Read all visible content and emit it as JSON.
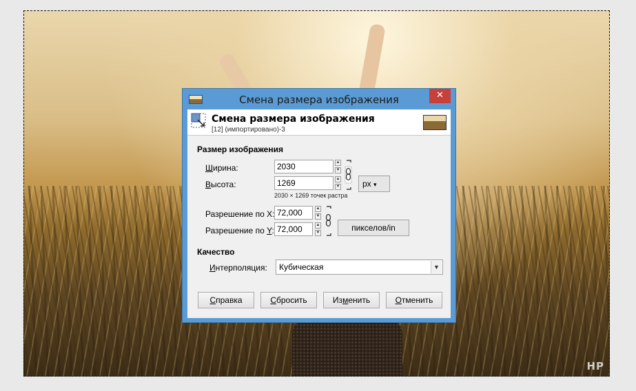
{
  "dialog": {
    "window_title": "Смена размера изображения",
    "header_title": "Смена размера изображения",
    "header_subtitle": "[12] (импортировано)-3",
    "close_glyph": "✕"
  },
  "image_size": {
    "section_label": "Размер изображения",
    "width_label": "Ширина:",
    "width_accel": "Ш",
    "width_rest": "ирина:",
    "width_value": "2030",
    "height_label": "Высота:",
    "height_accel": "В",
    "height_rest": "ысота:",
    "height_value": "1269",
    "unit": "px",
    "pixel_info": "2030 × 1269 точек растра",
    "res_x_label": "Разрешение по X:",
    "res_x_value": "72,000",
    "res_y_label": "Разрешение по Y:",
    "res_y_accel": "Y",
    "res_y_prefix": "Разрешение по ",
    "res_y_suffix": ":",
    "res_y_value": "72,000",
    "res_unit": "пикселов/in"
  },
  "quality": {
    "section_label": "Качество",
    "interp_label": "Интерполяция:",
    "interp_accel": "И",
    "interp_rest": "нтерполяция:",
    "interp_value": "Кубическая"
  },
  "buttons": {
    "help": {
      "accel": "С",
      "rest": "правка",
      "label": "Справка"
    },
    "reset": {
      "accel": "С",
      "rest": "бросить",
      "label": "Сбросить"
    },
    "resize": {
      "prefix": "Из",
      "accel": "м",
      "rest": "енить",
      "label": "Изменить"
    },
    "cancel": {
      "accel": "О",
      "rest": "тменить",
      "label": "Отменить"
    }
  },
  "watermark": "HP",
  "icons": {
    "chain": "chain-link-icon",
    "spin_up": "▲",
    "spin_down": "▼",
    "dropdown": "▼"
  },
  "colors": {
    "title_bar": "#5b9bd5",
    "close_button": "#c7403a",
    "dialog_body": "#f0f0f0"
  }
}
